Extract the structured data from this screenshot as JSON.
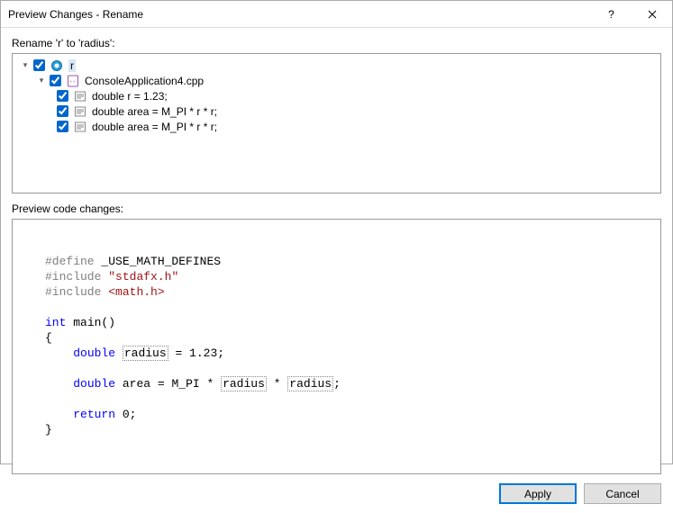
{
  "title": "Preview Changes - Rename",
  "heading": "Rename 'r' to 'radius':",
  "tree": {
    "root": {
      "label": "r"
    },
    "file": {
      "label": "ConsoleApplication4.cpp"
    },
    "refs": [
      "double r = 1.23;",
      "double area = M_PI * r * r;",
      "double area = M_PI * r * r;"
    ]
  },
  "previewLabel": "Preview code changes:",
  "code": {
    "define": "#define",
    "definesym": "_USE_MATH_DEFINES",
    "include": "#include",
    "inc1": "\"stdafx.h\"",
    "inc2": "<math.h>",
    "kw_int": "int",
    "main": "main()",
    "kw_double": "double",
    "var_radius": "radius",
    "eq1": " = 1.23;",
    "var_area": "area",
    "eq2": " = M_PI * ",
    "times": " * ",
    "semi": ";",
    "kw_return": "return",
    "zero": " 0;"
  },
  "buttons": {
    "apply": "Apply",
    "cancel": "Cancel"
  }
}
